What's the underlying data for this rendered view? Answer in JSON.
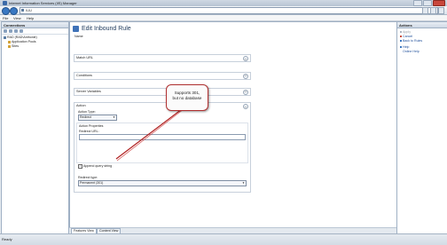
{
  "window": {
    "title": "Internet Information Services (IIS) Manager"
  },
  "address": {
    "crumb": "IUU"
  },
  "menu": [
    "File",
    "View",
    "Help"
  ],
  "connections": {
    "header": "Connections",
    "tree": [
      "RAD (RAD\\Anthonie)",
      "Application Pools",
      "Sites"
    ]
  },
  "main": {
    "heading": "Edit Inbound Rule",
    "name_label": "Name",
    "sections": [
      "Match URL",
      "Conditions",
      "Server Variables"
    ],
    "action": {
      "label": "Action",
      "type_label": "Action Type:",
      "type_value": "Redirect",
      "props_label": "Action Properties",
      "redirect_url_label": "Redirect URL:",
      "redirect_url_value": "",
      "append_qs_label": "Append query string",
      "append_qs_checked": true,
      "redirect_type_label": "Redirect type:",
      "redirect_type_value": "Permanent (301)"
    }
  },
  "callout": {
    "line1": "Supports 301,",
    "line2": "but no database"
  },
  "actions": {
    "header": "Actions",
    "items": [
      {
        "label": "Apply",
        "enabled": false
      },
      {
        "label": "Cancel",
        "enabled": true
      },
      {
        "label": "Back to Rules",
        "enabled": true
      }
    ],
    "help_items": [
      "Help",
      "Online Help"
    ]
  },
  "view_tabs": [
    "Features View",
    "Content View"
  ],
  "status": "Ready"
}
